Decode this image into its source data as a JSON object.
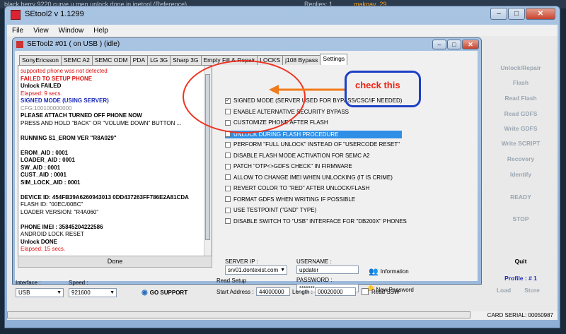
{
  "background": {
    "line1": "black berry 9220 curve u mep unlock done in igetool (Reference)",
    "replies": "Replies: 1",
    "user": "makpay_29"
  },
  "outer_window": {
    "title": "SEtool2 v 1.1299"
  },
  "menu": [
    "File",
    "View",
    "Window",
    "Help"
  ],
  "inner_window": {
    "title": "SETool2 #01 ( on USB ) (idle)"
  },
  "tabs": [
    "SonyEricsson",
    "SEMC A2",
    "SEMC ODM",
    "PDA",
    "LG 3G",
    "Sharp 3G",
    "Empty Fill & Repair",
    "LOCKS",
    "j108 Bypass",
    "Settings"
  ],
  "active_tab": "Settings",
  "log": [
    {
      "text": "supported phone was not detected",
      "color": "#d11"
    },
    {
      "text": "FAILED TO SETUP PHONE",
      "color": "#d11"
    },
    {
      "text": "Unlock FAILED",
      "color": "#000"
    },
    {
      "text": "Elapsed: 9 secs.",
      "color": "#d11"
    },
    {
      "text": "SIGNED MODE (USING SERVER)",
      "color": "#1a2bb8"
    },
    {
      "text": "CFG:100100000000",
      "color": "#888"
    },
    {
      "text": "PLEASE ATTACH TURNED OFF PHONE NOW",
      "color": "#000"
    },
    {
      "text": "PRESS AND HOLD \"BACK\" OR \"VOLUME DOWN\" BUTTON ...",
      "color": "#000"
    },
    {
      "text": "",
      "color": "#000"
    },
    {
      "text": "RUNNING S1_EROM VER \"R8A029\"",
      "color": "#000"
    },
    {
      "text": "",
      "color": "#000"
    },
    {
      "text": "EROM_AID : 0001",
      "color": "#000"
    },
    {
      "text": "LOADER_AID : 0001",
      "color": "#000"
    },
    {
      "text": "SW_AID : 0001",
      "color": "#000"
    },
    {
      "text": "CUST_AID : 0001",
      "color": "#000"
    },
    {
      "text": "SIM_LOCK_AID : 0001",
      "color": "#000"
    },
    {
      "text": "",
      "color": "#000"
    },
    {
      "text": "DEVICE ID: 454FB39A6260943013 0DD437263FF786E2A81CDA",
      "color": "#000"
    },
    {
      "text": "FLASH ID: \"00EC/00BC\"",
      "color": "#000"
    },
    {
      "text": "LOADER VERSION: \"R4A060\"",
      "color": "#000"
    },
    {
      "text": "",
      "color": "#000"
    },
    {
      "text": "PHONE IMEI : 35845204222586",
      "color": "#000"
    },
    {
      "text": "ANDROID LOCK RESET",
      "color": "#000"
    },
    {
      "text": "Unlock DONE",
      "color": "#000"
    },
    {
      "text": "Elapsed: 15 secs.",
      "color": "#d11"
    }
  ],
  "done_label": "Done",
  "options": [
    {
      "label": "SIGNED MODE (SERVER USED FOR BYPASS/CSC/IF NEEDED)",
      "checked": true
    },
    {
      "label": "ENABLE ALTERNATIVE SECURITY BYPASS",
      "checked": false
    },
    {
      "label": "CUSTOMIZE PHONE AFTER FLASH",
      "checked": false
    },
    {
      "label": "UNLOCK DURING FLASH PROCEDURE",
      "checked": true,
      "highlighted": true
    },
    {
      "label": "PERFORM \"FULL UNLOCK\" INSTEAD OF \"USERCODE RESET\"",
      "checked": false
    },
    {
      "label": "DISABLE FLASH MODE ACTIVATION FOR SEMC A2",
      "checked": false
    },
    {
      "label": "PATCH \"OTP<>GDFS CHECK\" IN FIRMWARE",
      "checked": false
    },
    {
      "label": "ALLOW TO CHANGE IMEI WHEN UNLOCKING (IT IS CRIME)",
      "checked": false
    },
    {
      "label": "REVERT COLOR TO \"RED\" AFTER UNLOCK/FLASH",
      "checked": false
    },
    {
      "label": "FORMAT GDFS WHEN WRITING IF POSSIBLE",
      "checked": false
    },
    {
      "label": "USE TESTPOINT (\"GND\" TYPE)",
      "checked": false
    },
    {
      "label": "DISABLE SWITCH TO \"USB\" INTERFACE FOR \"DB200X\" PHONES",
      "checked": false
    }
  ],
  "server": {
    "label": "SERVER IP :",
    "value": "srv01.dontexist.com"
  },
  "username": {
    "label": "USERNAME :",
    "value": "updater"
  },
  "password": {
    "label": "PASSWORD :",
    "value": "*******"
  },
  "information_label": "Information",
  "new_password_label": "New Password",
  "right_buttons": [
    "Unlock/Repair",
    "Flash",
    "Read Flash",
    "Read GDFS",
    "Write GDFS",
    "Write SCRIPT",
    "Recovery",
    "Identify",
    "READY",
    "STOP",
    "Quit"
  ],
  "profile": {
    "label": "Profile : # 1",
    "load": "Load",
    "store": "Store"
  },
  "interface": {
    "label": "Interface :",
    "value": "USB"
  },
  "speed": {
    "label": "Speed :",
    "value": "921600"
  },
  "go_support": "GO SUPPORT",
  "read_setup": {
    "label": "Read Setup",
    "start_label": "Start Address :",
    "start_value": "44000000",
    "length_label": "Length :",
    "length_value": "00020000",
    "ssw_label": "Read SSW"
  },
  "card_serial": "CARD SERIAL: 00050987",
  "annotation": {
    "text": "check this",
    "ellipse_color": "#e32",
    "box_color": "#1d3fc6",
    "arrow_color": "#f07a1a"
  }
}
